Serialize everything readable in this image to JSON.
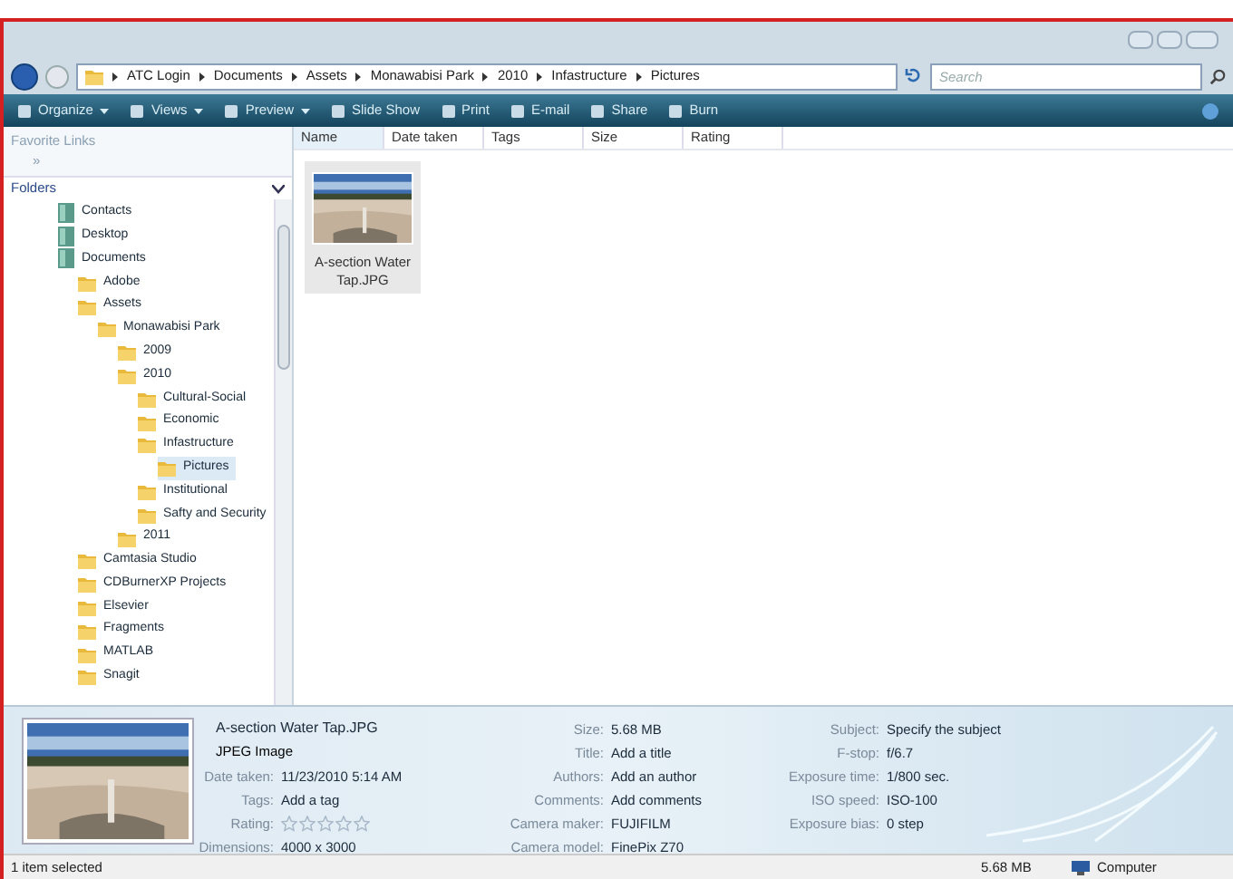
{
  "address_bar": {
    "crumbs": [
      "ATC Login",
      "Documents",
      "Assets",
      "Monawabisi Park",
      "2010",
      "Infastructure",
      "Pictures"
    ]
  },
  "search": {
    "placeholder": "Search"
  },
  "toolbar": [
    {
      "label": "Organize",
      "dropdown": true
    },
    {
      "label": "Views",
      "dropdown": true
    },
    {
      "label": "Preview",
      "dropdown": true
    },
    {
      "label": "Slide Show",
      "dropdown": false
    },
    {
      "label": "Print",
      "dropdown": false
    },
    {
      "label": "E-mail",
      "dropdown": false
    },
    {
      "label": "Share",
      "dropdown": false
    },
    {
      "label": "Burn",
      "dropdown": false
    }
  ],
  "favorite_links": {
    "title": "Favorite Links",
    "more": "»"
  },
  "folders": {
    "title": "Folders",
    "items": [
      {
        "label": "Contacts",
        "kind": "special",
        "selected": false
      },
      {
        "label": "Desktop",
        "kind": "special",
        "selected": false
      },
      {
        "label": "Documents",
        "kind": "special",
        "selected": false,
        "children": [
          {
            "label": "Adobe",
            "kind": "folder",
            "selected": false
          },
          {
            "label": "Assets",
            "kind": "folder",
            "selected": false,
            "children": [
              {
                "label": "Monawabisi Park",
                "kind": "folder",
                "selected": false,
                "children": [
                  {
                    "label": "2009",
                    "kind": "folder",
                    "selected": false
                  },
                  {
                    "label": "2010",
                    "kind": "folder",
                    "selected": false,
                    "children": [
                      {
                        "label": "Cultural-Social",
                        "kind": "folder",
                        "selected": false
                      },
                      {
                        "label": "Economic",
                        "kind": "folder",
                        "selected": false
                      },
                      {
                        "label": "Infastructure",
                        "kind": "folder",
                        "selected": false,
                        "children": [
                          {
                            "label": "Pictures",
                            "kind": "folder",
                            "selected": true
                          }
                        ]
                      },
                      {
                        "label": "Institutional",
                        "kind": "folder",
                        "selected": false
                      },
                      {
                        "label": "Safty and Security",
                        "kind": "folder",
                        "selected": false
                      }
                    ]
                  },
                  {
                    "label": "2011",
                    "kind": "folder",
                    "selected": false
                  }
                ]
              }
            ]
          },
          {
            "label": "Camtasia Studio",
            "kind": "folder",
            "selected": false
          },
          {
            "label": "CDBurnerXP Projects",
            "kind": "folder",
            "selected": false
          },
          {
            "label": "Elsevier",
            "kind": "folder",
            "selected": false
          },
          {
            "label": "Fragments",
            "kind": "folder",
            "selected": false
          },
          {
            "label": "MATLAB",
            "kind": "folder",
            "selected": false
          },
          {
            "label": "Snagit",
            "kind": "folder",
            "selected": false
          }
        ]
      }
    ]
  },
  "columns": [
    "Name",
    "Date taken",
    "Tags",
    "Size",
    "Rating"
  ],
  "files": [
    {
      "name": "A-section Water Tap.JPG",
      "kind": "picture",
      "selected": true
    }
  ],
  "details": {
    "name": "A-section Water Tap.JPG",
    "type": "JPEG Image",
    "col1": [
      {
        "label": "Date taken:",
        "value": "11/23/2010 5:14 AM"
      },
      {
        "label": "Tags:",
        "value": "Add a tag"
      },
      {
        "label": "Rating:",
        "stars": 0
      },
      {
        "label": "Dimensions:",
        "value": "4000 x 3000"
      }
    ],
    "col2": [
      {
        "label": "Size:",
        "value": "5.68 MB"
      },
      {
        "label": "Title:",
        "value": "Add a title"
      },
      {
        "label": "Authors:",
        "value": "Add an author"
      },
      {
        "label": "Comments:",
        "value": "Add comments"
      },
      {
        "label": "Camera maker:",
        "value": "FUJIFILM"
      },
      {
        "label": "Camera model:",
        "value": "FinePix Z70"
      }
    ],
    "col3": [
      {
        "label": "Subject:",
        "value": "Specify the subject"
      },
      {
        "label": "F-stop:",
        "value": "f/6.7"
      },
      {
        "label": "Exposure time:",
        "value": "1/800 sec."
      },
      {
        "label": "ISO speed:",
        "value": "ISO-100"
      },
      {
        "label": "Exposure bias:",
        "value": "0 step"
      }
    ]
  },
  "status_bar": {
    "text": "1 item selected",
    "size": "5.68 MB",
    "zone": "Computer"
  }
}
